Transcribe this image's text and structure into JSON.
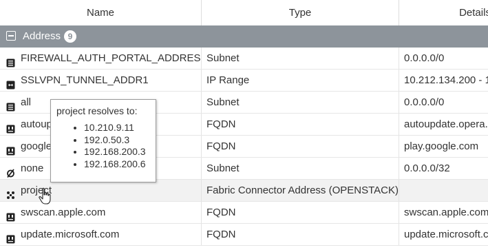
{
  "columns": {
    "name": "Name",
    "type": "Type",
    "details": "Details"
  },
  "group": {
    "title": "Address",
    "count": "9"
  },
  "rows": [
    {
      "name": "FIREWALL_AUTH_PORTAL_ADDRESS",
      "type": "Subnet",
      "details": "0.0.0.0/0",
      "icon": "subnet-icon"
    },
    {
      "name": "SSLVPN_TUNNEL_ADDR1",
      "type": "IP Range",
      "details": "10.212.134.200 - 1",
      "icon": "ip-range-icon"
    },
    {
      "name": "all",
      "type": "Subnet",
      "details": "0.0.0.0/0",
      "icon": "subnet-icon"
    },
    {
      "name": "autoup",
      "type": "FQDN",
      "details": "autoupdate.opera.c",
      "icon": "fqdn-icon"
    },
    {
      "name": "google",
      "type": "FQDN",
      "details": "play.google.com",
      "icon": "fqdn-icon"
    },
    {
      "name": "none",
      "type": "Subnet",
      "details": "0.0.0.0/32",
      "icon": "none-icon"
    },
    {
      "name": "project",
      "type": "Fabric Connector Address (OPENSTACK)",
      "details": "",
      "icon": "fabric-connector-icon"
    },
    {
      "name": "swscan.apple.com",
      "type": "FQDN",
      "details": "swscan.apple.com",
      "icon": "fqdn-icon"
    },
    {
      "name": "update.microsoft.com",
      "type": "FQDN",
      "details": "update.microsoft.c",
      "icon": "fqdn-icon"
    }
  ],
  "tooltip": {
    "title": "project resolves to:",
    "items": [
      "10.210.9.11",
      "192.0.50.3",
      "192.168.200.3",
      "192.168.200.6"
    ]
  },
  "colors": {
    "group_bg": "#8d949b",
    "highlight_row": "#f2f2f2"
  }
}
